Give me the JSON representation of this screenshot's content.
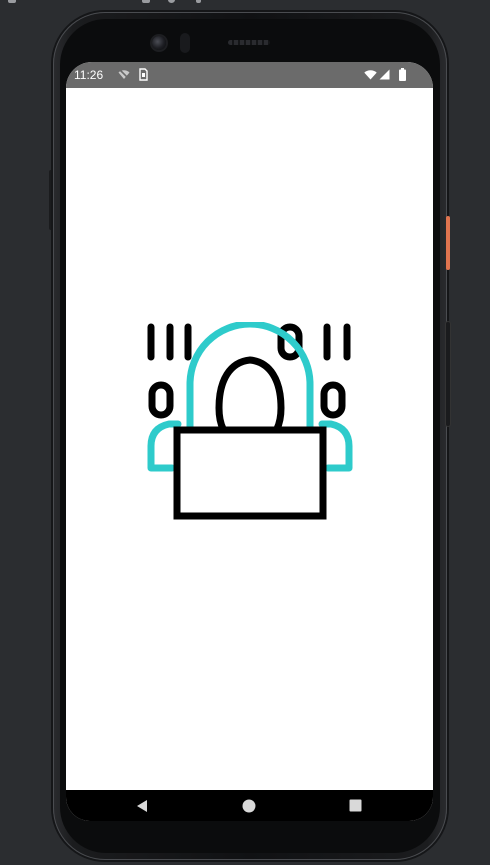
{
  "status_bar": {
    "time": "11:26",
    "icons": [
      "wifi-off-icon",
      "sim-card-icon",
      "wifi-icon",
      "cellular-signal-icon",
      "battery-icon"
    ],
    "background_color": "#6b6b6b"
  },
  "content": {
    "illustration": "hacker-icon",
    "binary_top": "IIIOOII",
    "binary_bottom": "OO",
    "colors": {
      "accent": "#2ecbcb",
      "stroke": "#000000",
      "background": "#ffffff"
    }
  },
  "nav_bar": {
    "buttons": [
      "back-icon",
      "home-icon",
      "recents-icon"
    ]
  },
  "device": {
    "side_button_color": "#e0744f"
  }
}
